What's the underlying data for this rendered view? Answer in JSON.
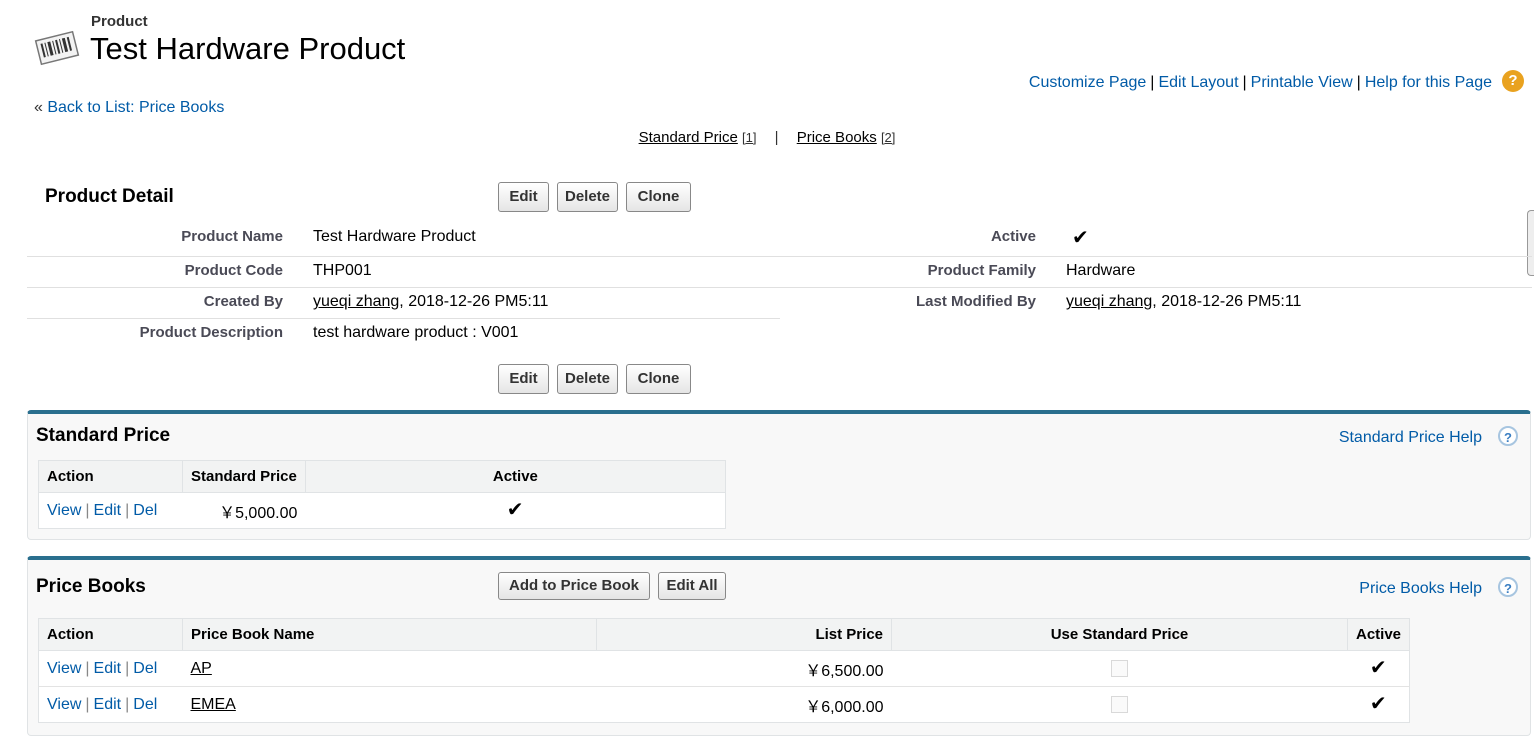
{
  "header": {
    "object_type": "Product",
    "title": "Test Hardware Product",
    "top_links": [
      "Customize Page",
      "Edit Layout",
      "Printable View",
      "Help for this Page"
    ],
    "back_link": "Back to List: Price Books",
    "back_arrow": "«"
  },
  "jump_links": [
    {
      "label": "Standard Price",
      "count": "[1]"
    },
    {
      "label": "Price Books",
      "count": "[2]"
    }
  ],
  "detail": {
    "section_title": "Product Detail",
    "buttons": [
      "Edit",
      "Delete",
      "Clone"
    ],
    "fields": {
      "product_name": {
        "label": "Product Name",
        "value": "Test Hardware Product"
      },
      "active": {
        "label": "Active",
        "checked": true
      },
      "product_code": {
        "label": "Product Code",
        "value": "THP001"
      },
      "product_family": {
        "label": "Product Family",
        "value": "Hardware"
      },
      "created_by": {
        "label": "Created By",
        "user": "yueqi zhang",
        "date": ", 2018-12-26 PM5:11"
      },
      "last_modified_by": {
        "label": "Last Modified By",
        "user": "yueqi zhang",
        "date": ", 2018-12-26 PM5:11"
      },
      "product_description": {
        "label": "Product Description",
        "value": "test hardware product : V001"
      }
    }
  },
  "standard_price": {
    "title": "Standard Price",
    "help": "Standard Price Help",
    "columns": [
      "Action",
      "Standard Price",
      "Active"
    ],
    "rows": [
      {
        "actions": [
          "View",
          "Edit",
          "Del"
        ],
        "price": "￥5,000.00",
        "active": true
      }
    ]
  },
  "price_books": {
    "title": "Price Books",
    "buttons": [
      "Add to Price Book",
      "Edit All"
    ],
    "help": "Price Books Help",
    "columns": [
      "Action",
      "Price Book Name",
      "List Price",
      "Use Standard Price",
      "Active"
    ],
    "rows": [
      {
        "actions": [
          "View",
          "Edit",
          "Del"
        ],
        "name": "AP",
        "list_price": "￥6,500.00",
        "use_standard": false,
        "active": true
      },
      {
        "actions": [
          "View",
          "Edit",
          "Del"
        ],
        "name": "EMEA",
        "list_price": "￥6,000.00",
        "use_standard": false,
        "active": true
      }
    ]
  },
  "icons": {
    "product": "barcode-icon",
    "help": "question-mark-icon",
    "check": "checkmark-icon"
  },
  "colors": {
    "link": "#015ba7",
    "section_border": "#2a6f8e",
    "help_orange": "#e9a21f"
  }
}
